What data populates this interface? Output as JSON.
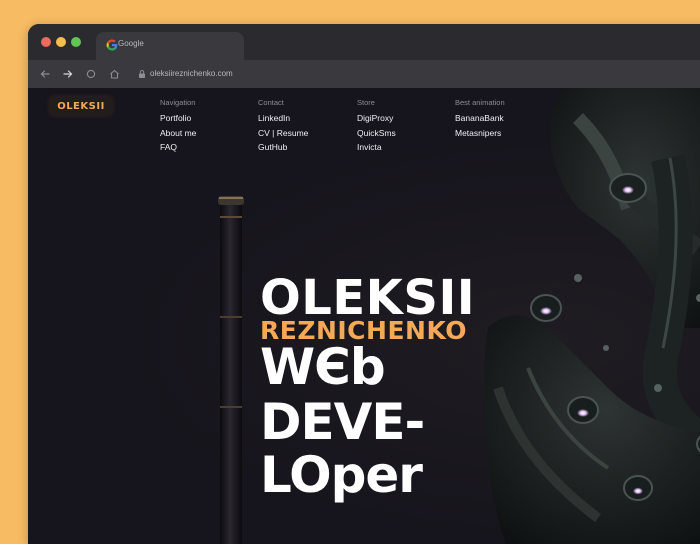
{
  "browser": {
    "tab_title": "Google",
    "url": "oleksiireznichenko.com"
  },
  "site": {
    "logo": "OLEKSII",
    "nav": [
      {
        "heading": "Navigation",
        "links": [
          "Portfolio",
          "About me",
          "FAQ"
        ]
      },
      {
        "heading": "Contact",
        "links": [
          "LinkedIn",
          "CV | Resume",
          "GutHub"
        ]
      },
      {
        "heading": "Store",
        "links": [
          "DigiProxy",
          "QuickSms",
          "Invicta"
        ]
      },
      {
        "heading": "Best animation",
        "links": [
          "BananaBank",
          "Metasnipers"
        ]
      }
    ],
    "hero": {
      "line1": "OLEKSII",
      "line2": "REZNICHENKO",
      "line3": "WЄb",
      "line4": "DEVE-",
      "line5": "LOper"
    }
  },
  "colors": {
    "background": "#F6BB63",
    "accent": "#F5A855",
    "page": "#16141C"
  },
  "icons": [
    "back-arrow-icon",
    "forward-arrow-icon",
    "reload-icon",
    "home-icon",
    "lock-icon",
    "google-icon"
  ]
}
